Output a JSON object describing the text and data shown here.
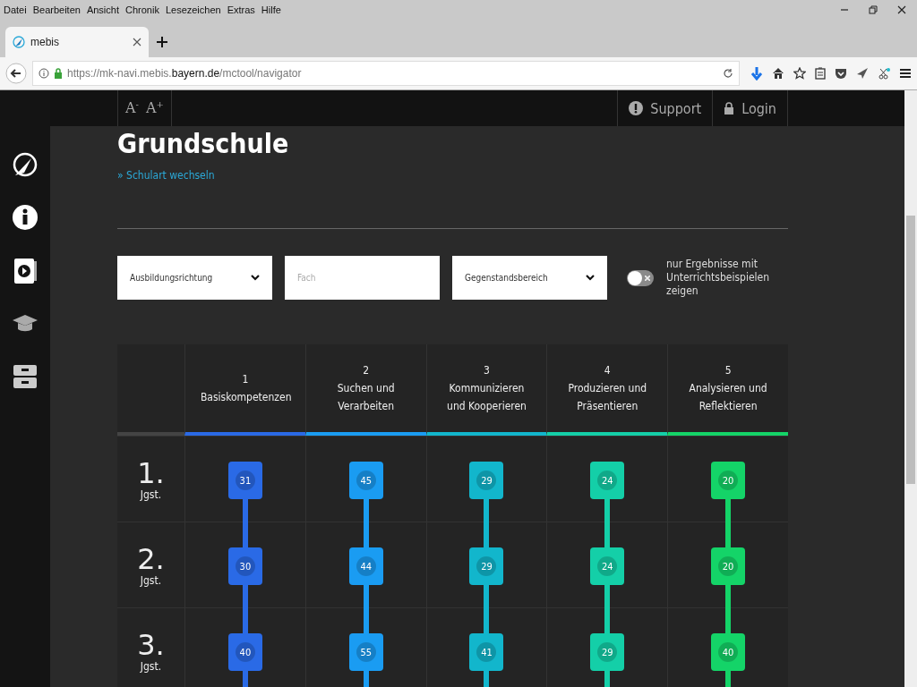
{
  "browser": {
    "menu": [
      "Datei",
      "Bearbeiten",
      "Ansicht",
      "Chronik",
      "Lesezeichen",
      "Extras",
      "Hilfe"
    ],
    "tab": {
      "title": "mebis"
    },
    "url": {
      "scheme": "https://mk-navi.mebis.",
      "domain": "bayern.de",
      "path": "/mctool/navigator"
    }
  },
  "topbar": {
    "font_buttons": [
      {
        "letter": "A",
        "sign": "-"
      },
      {
        "letter": "A",
        "sign": "+"
      }
    ],
    "links": [
      {
        "kind": "support",
        "label": "Support"
      },
      {
        "kind": "login",
        "label": "Login"
      }
    ]
  },
  "sidebar": {
    "items": [
      {
        "kind": "compass"
      },
      {
        "kind": "info"
      },
      {
        "kind": "video"
      },
      {
        "kind": "cap"
      },
      {
        "kind": "archive"
      }
    ]
  },
  "heading": "Grundschule",
  "change_link": "» Schulart wechseln",
  "filters": [
    {
      "kind": "select",
      "label": "Ausbildungsrichtung"
    },
    {
      "kind": "text",
      "placeholder": "Fach"
    },
    {
      "kind": "select",
      "label": "Gegenstandsbereich"
    }
  ],
  "toggle": {
    "on": false,
    "label": "nur Ergebnisse mit Unterrichtsbeispielen zeigen"
  },
  "columns": [
    {
      "number": "1",
      "title": "Basiskompetenzen",
      "color": "#2a6ae6"
    },
    {
      "number": "2",
      "title": "Suchen und Verarbeiten",
      "color": "#1a9cf2"
    },
    {
      "number": "3",
      "title": "Kommunizieren und Kooperieren",
      "color": "#12b6cc"
    },
    {
      "number": "4",
      "title": "Produzieren und Präsentieren",
      "color": "#14cfa8"
    },
    {
      "number": "5",
      "title": "Analysieren und Reflektieren",
      "color": "#14d468"
    }
  ],
  "rows": [
    {
      "grade": "1.",
      "unit": "Jgst.",
      "counts": [
        "31",
        "45",
        "29",
        "24",
        "20"
      ]
    },
    {
      "grade": "2.",
      "unit": "Jgst.",
      "counts": [
        "30",
        "44",
        "29",
        "24",
        "20"
      ]
    },
    {
      "grade": "3.",
      "unit": "Jgst.",
      "counts": [
        "40",
        "55",
        "41",
        "29",
        "40"
      ]
    }
  ]
}
